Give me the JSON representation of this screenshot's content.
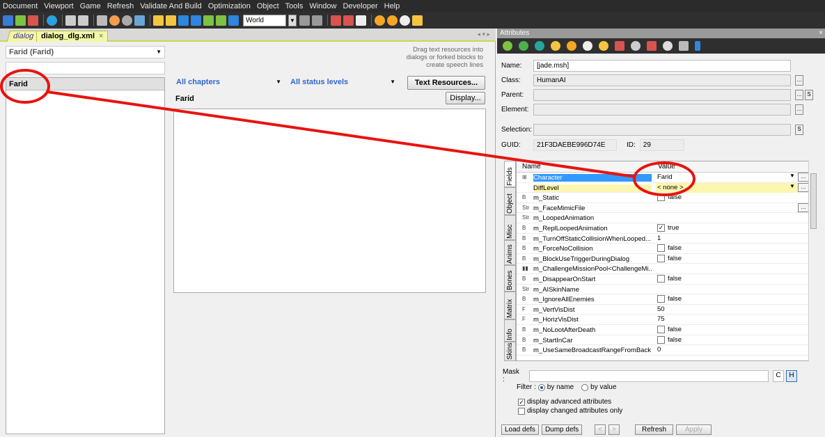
{
  "menu": [
    "Document",
    "Viewport",
    "Game",
    "Refresh",
    "Validate And Build",
    "Optimization",
    "Object",
    "Tools",
    "Window",
    "Developer",
    "Help"
  ],
  "toolbar": {
    "world_label": "World"
  },
  "tabs": [
    {
      "label": "dialog"
    },
    {
      "label": "dialog_dlg.xml",
      "close": "×"
    }
  ],
  "tab_nav": "◂ ▾ ▸",
  "character_select": {
    "value": "Farid (Farid)"
  },
  "character_list": [
    {
      "label": "Farid"
    }
  ],
  "hint_text": "Drag text resources into dialogs or forked blocks to create speech lines",
  "filters": {
    "chapters": "All chapters",
    "status": "All status levels"
  },
  "buttons": {
    "text_resources": "Text Resources...",
    "display": "Display..."
  },
  "npc_name": "Farid",
  "attributes": {
    "title": "Attributes",
    "close": "×",
    "name_label": "Name:",
    "name_value": "[jade.msh]",
    "class_label": "Class:",
    "class_value": "HumanAI",
    "parent_label": "Parent:",
    "element_label": "Element:",
    "selection_label": "Selection:",
    "guid_label": "GUID:",
    "guid_value": "21F3DAEBE996D74E",
    "id_label": "ID:",
    "id_value": "29",
    "ellipsis": "...",
    "s_btn": "S",
    "grid_headers": {
      "name": "Name",
      "value": "Value"
    },
    "rows": [
      {
        "type": "⊞",
        "name": "Character",
        "value": "Farid",
        "style": "sel",
        "dropdown": true,
        "more": true
      },
      {
        "type": "",
        "name": "DiffLevel",
        "value": "< none >",
        "style": "yel",
        "dropdown": true,
        "more": true
      },
      {
        "type": "B",
        "name": "m_Static",
        "value": "false",
        "check": false
      },
      {
        "type": "Str",
        "name": "m_FaceMimicFile",
        "value": "",
        "more": true
      },
      {
        "type": "Str",
        "name": "m_LoopedAnimation",
        "value": ""
      },
      {
        "type": "B",
        "name": "m_ReplLoopedAnimation",
        "value": "true",
        "check": true
      },
      {
        "type": "B",
        "name": "m_TurnOffStaticCollisionWhenLooped...",
        "value": "1"
      },
      {
        "type": "B",
        "name": "m_ForceNoCollision",
        "value": "false",
        "check": false
      },
      {
        "type": "B",
        "name": "m_BlockUseTriggerDuringDialog",
        "value": "false",
        "check": false
      },
      {
        "type": "▮▮",
        "name": "m_ChallengeMissionPool<ChallengeMi...",
        "value": ""
      },
      {
        "type": "B",
        "name": "m_DisappearOnStart",
        "value": "false",
        "check": false
      },
      {
        "type": "Str",
        "name": "m_AISkinName",
        "value": ""
      },
      {
        "type": "B",
        "name": "m_IgnoreAllEnemies",
        "value": "false",
        "check": false
      },
      {
        "type": "F",
        "name": "m_VertVisDist",
        "value": "50"
      },
      {
        "type": "F",
        "name": "m_HorizVisDist",
        "value": "75"
      },
      {
        "type": "B",
        "name": "m_NoLootAfterDeath",
        "value": "false",
        "check": false
      },
      {
        "type": "B",
        "name": "m_StartInCar",
        "value": "false",
        "check": false
      },
      {
        "type": "B",
        "name": "m_UseSameBroadcastRangeFromBack",
        "value": "0"
      }
    ],
    "side_tabs": [
      "Fields",
      "Object",
      "Misc",
      "Anims",
      "Bones",
      "Matrix",
      "Info",
      "Skins"
    ],
    "mask_label": "Mask :",
    "c_btn": "C",
    "h_btn": "H",
    "filter_label": "Filter :",
    "by_name": "by name",
    "by_value": "by value",
    "adv_attrs": "display advanced attributes",
    "changed_only": "display changed attributes only",
    "footer": {
      "load_defs": "Load defs",
      "dump_defs": "Dump defs",
      "prev": "<",
      "next": ">",
      "refresh": "Refresh",
      "apply": "Apply"
    }
  },
  "colors": {
    "annotation": "#e8130f",
    "selection": "#3399ff",
    "filter_text": "#3366cc"
  }
}
